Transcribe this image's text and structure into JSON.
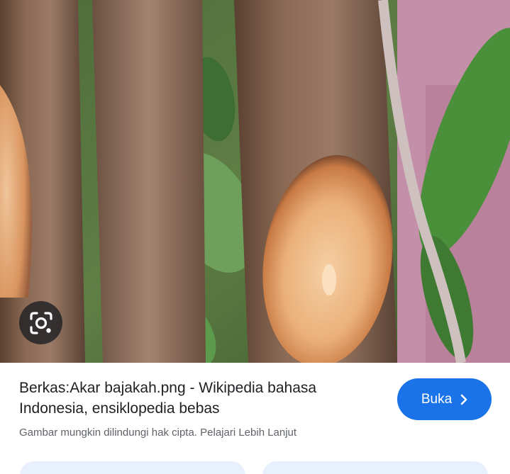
{
  "result": {
    "title": "Berkas:Akar bajakah.png - Wikipedia bahasa Indonesia, ensiklopedia bebas",
    "copyright_notice": "Gambar mungkin dilindungi hak cipta.",
    "learn_more_label": "Pelajari Lebih Lanjut"
  },
  "actions": {
    "open_label": "Buka",
    "open_icon": "chevron-right-icon",
    "lens_icon": "google-lens-icon"
  },
  "colors": {
    "accent": "#1a73e8",
    "title_text": "#202124",
    "secondary_text": "#5f6368",
    "pill_bg": "#e8f0fe"
  }
}
